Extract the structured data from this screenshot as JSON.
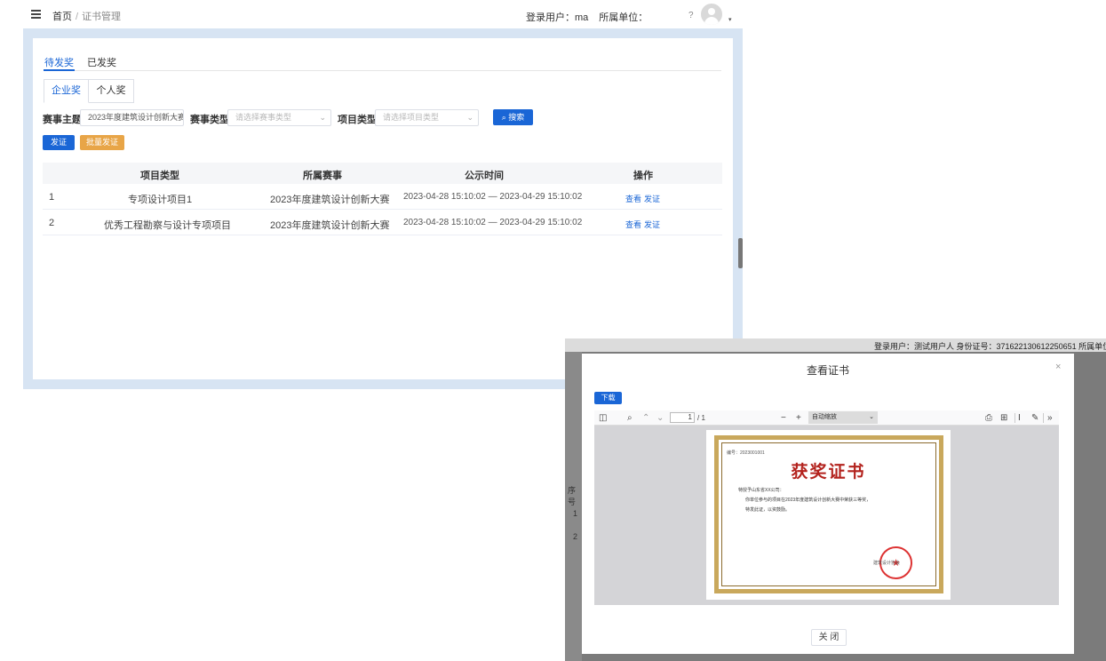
{
  "header": {
    "breadcrumb_home": "首页",
    "breadcrumb_sep": "/",
    "breadcrumb_current": "证书管理",
    "login_user_label": "登录用户：",
    "login_user_value": "ma",
    "unit_label": "所属单位：",
    "help_icon": "?",
    "caret_icon": "▾"
  },
  "status_tabs": [
    "待发奖",
    "已发奖"
  ],
  "type_tabs": [
    "企业奖",
    "个人奖"
  ],
  "filters": {
    "topic_label": "赛事主题",
    "topic_value": "2023年度建筑设计创新大赛",
    "type_label": "赛事类型",
    "type_placeholder": "请选择赛事类型",
    "project_label": "项目类型",
    "project_placeholder": "请选择项目类型",
    "search_button": "搜索"
  },
  "actions": {
    "issue_button": "发证",
    "batch_button": "批量发证"
  },
  "table": {
    "columns": [
      "项目类型",
      "所属赛事",
      "公示时间",
      "操作"
    ],
    "rows": [
      {
        "index": "1",
        "project_type": "专项设计项目1",
        "event": "2023年度建筑设计创新大赛",
        "time": "2023-04-28 15:10:02 — 2023-04-29 15:10:02",
        "op_view": "查看",
        "op_issue": "发证"
      },
      {
        "index": "2",
        "project_type": "优秀工程勘察与设计专项项目",
        "event": "2023年度建筑设计创新大赛",
        "time": "2023-04-28 15:10:02 — 2023-04-29 15:10:02",
        "op_view": "查看",
        "op_issue": "发证"
      }
    ]
  },
  "background_window": {
    "user_info": "登录用户：测试用户人   身份证号：371622130612250651   所属单位",
    "row_labels": [
      "序号",
      "1",
      "2"
    ]
  },
  "modal": {
    "title": "查看证书",
    "close_icon": "×",
    "download_button": "下载",
    "pdf_toolbar": {
      "page_value": "1",
      "page_total": "/ 1",
      "zoom_value": "自动缩放",
      "zoom_out": "−",
      "zoom_in": "+"
    },
    "certificate": {
      "number": "编号：2023001001",
      "title": "获奖证书",
      "line1": "特授予山东省XX公司：",
      "line2": "你单位参与的项目在2023年度建筑设计创新大赛中荣获三等奖，",
      "line3": "特发此证，以资鼓励。",
      "seal_text": "建筑设计协会"
    },
    "close_button": "关 闭"
  }
}
